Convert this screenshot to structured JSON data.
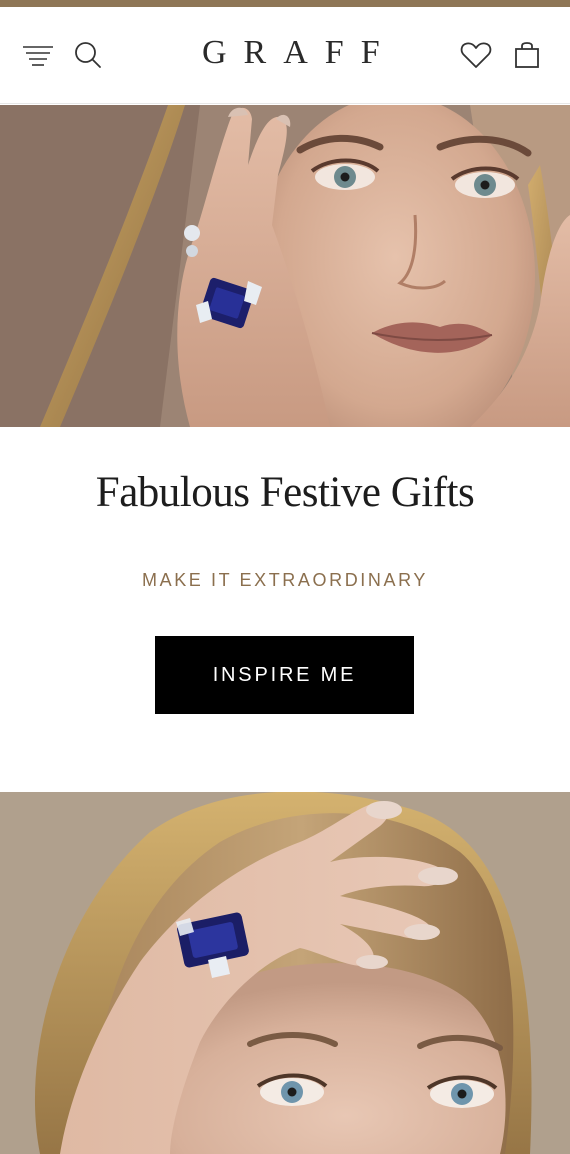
{
  "header": {
    "brand": "GRAFF",
    "icons": {
      "menu": "menu-icon",
      "search": "search-icon",
      "wishlist": "heart-icon",
      "bag": "shopping-bag-icon"
    }
  },
  "colors": {
    "accent": "#8b6f4e",
    "top_strip": "#8e7656",
    "button_bg": "#000000",
    "button_text": "#ffffff",
    "title_text": "#1d1d1d"
  },
  "promo": {
    "title": "Fabulous Festive Gifts",
    "subtitle": "MAKE IT EXTRAORDINARY",
    "cta_label": "INSPIRE ME"
  }
}
